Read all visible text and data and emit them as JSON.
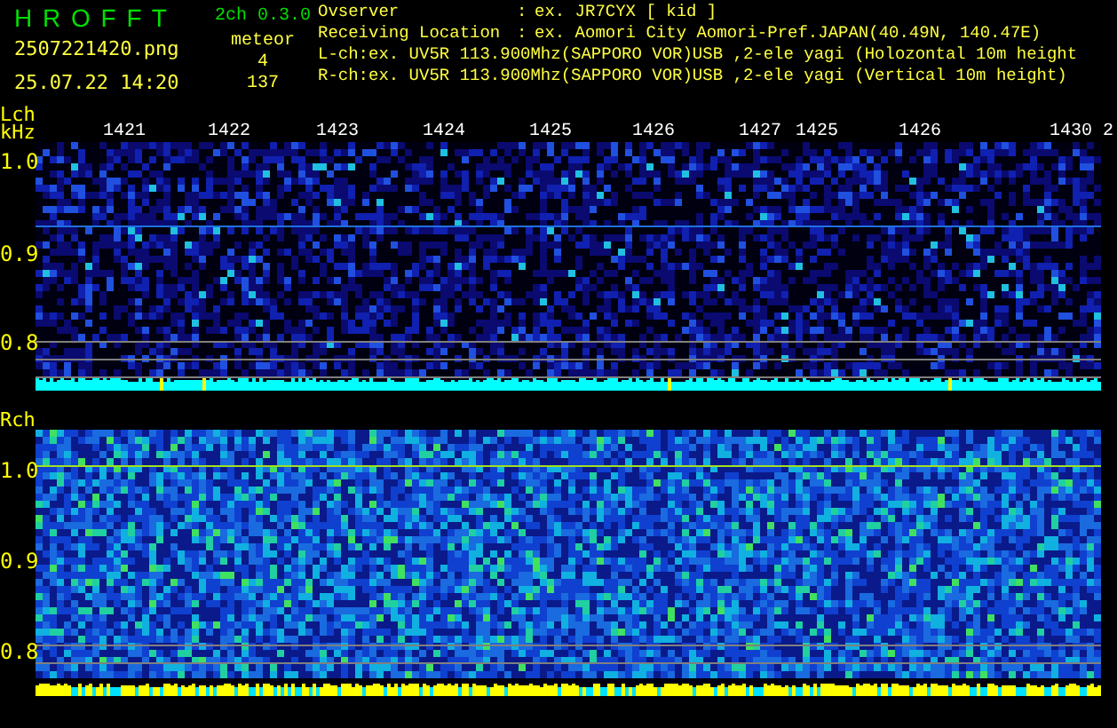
{
  "header": {
    "title": "H R O F F T",
    "version": "2ch 0.3.0",
    "filename": "2507221420.png",
    "datetime": "25.07.22 14:20",
    "meteor_label": "meteor",
    "counts": [
      "4",
      "137"
    ]
  },
  "info": [
    {
      "label": "Ovserver",
      "separator": ":",
      "value": "ex. JR7CYX [ kid ]"
    },
    {
      "label": "Receiving Location",
      "separator": ":",
      "value": "ex. Aomori City Aomori-Pref.JAPAN(40.49N, 140.47E)"
    }
  ],
  "channel_lines": [
    "L-ch:ex. UV5R 113.900Mhz(SAPPORO VOR)USB ,2-ele yagi (Holozontal 10m height",
    "R-ch:ex. UV5R 113.900Mhz(SAPPORO VOR)USB ,2-ele yagi (Vertical 10m height)"
  ],
  "panels": [
    {
      "label": "Lch",
      "unit": "kHz",
      "time_labels": [
        "1421",
        "1422",
        "1423",
        "1424",
        "1425",
        "1426",
        "1427",
        "1425",
        "1426",
        "1430",
        "2"
      ],
      "y_labels": [
        "1.0",
        "0.9",
        "0.8"
      ]
    },
    {
      "label": "Rch",
      "y_labels": [
        "1.0",
        "0.9",
        "0.8"
      ]
    }
  ]
}
